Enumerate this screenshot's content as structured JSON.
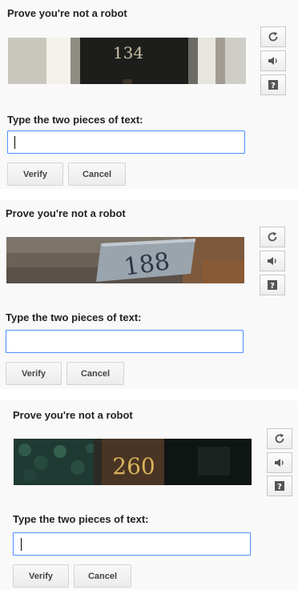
{
  "captchas": [
    {
      "title": "Prove you're not a robot",
      "image_text": "134",
      "instruction": "Type the two pieces of text:",
      "input_value": "",
      "input_placeholder": "",
      "verify_label": "Verify",
      "cancel_label": "Cancel"
    },
    {
      "title": "Prove you're not a robot",
      "image_text": "188",
      "instruction": "Type the two pieces of text:",
      "input_value": "",
      "input_placeholder": "",
      "verify_label": "Verify",
      "cancel_label": "Cancel"
    },
    {
      "title": "Prove you're not a robot",
      "image_text": "260",
      "instruction": "Type the two pieces of text:",
      "input_value": "",
      "input_placeholder": "",
      "verify_label": "Verify",
      "cancel_label": "Cancel"
    }
  ],
  "controls": {
    "reload_icon": "reload-icon",
    "audio_icon": "speaker-icon",
    "help_icon": "help-question-icon"
  },
  "colors": {
    "panel_bg": "#f9f9f9",
    "input_border": "#4d90fe",
    "button_border": "#d4d4d4"
  }
}
